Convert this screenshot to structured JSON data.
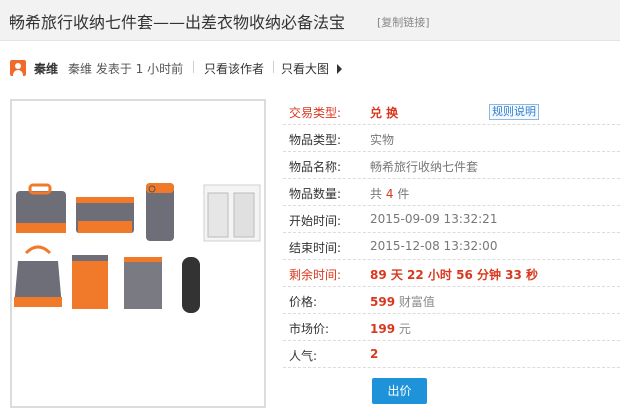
{
  "page": {
    "title": "畅希旅行收纳七件套——出差衣物收纳必备法宝",
    "copy_link": "[复制链接]"
  },
  "author_bar": {
    "avatar_icon": "user-avatar-icon",
    "author": "秦维",
    "post_info": "秦维 发表于 1 小时前",
    "only_author": "只看该作者",
    "big_image": "只看大图",
    "arrow_icon": "play-arrow-icon"
  },
  "product": {
    "image_caption": "",
    "fields": [
      {
        "label": "交易类型:",
        "value": "兑  换",
        "emphasis": true
      },
      {
        "label": "物品类型:",
        "value": "实物"
      },
      {
        "label": "物品名称:",
        "value": "畅希旅行收纳七件套"
      },
      {
        "label": "物品数量:",
        "value_prefix": "共",
        "value_num": "4",
        "value_suffix": "件"
      },
      {
        "label": "开始时间:",
        "value": "2015-09-09 13:32:21"
      },
      {
        "label": "结束时间:",
        "value": "2015-12-08 13:32:00"
      },
      {
        "label": "剩余时间:",
        "value": "89 天 22 小时 56 分钟 33 秒",
        "emphasis": true
      },
      {
        "label": "价格:",
        "value_num": "599",
        "value_suffix": "财富值"
      },
      {
        "label": "市场价:",
        "value_num": "199",
        "value_suffix": "元"
      },
      {
        "label": "人气:",
        "value_num": "2"
      }
    ],
    "rules_link": "规则说明",
    "bid_button": "出价"
  },
  "colors": {
    "accent_red": "#d9381e",
    "button_blue": "#1f93d9",
    "bag_gray": "#6e6e78",
    "bag_orange": "#f07a2a"
  }
}
